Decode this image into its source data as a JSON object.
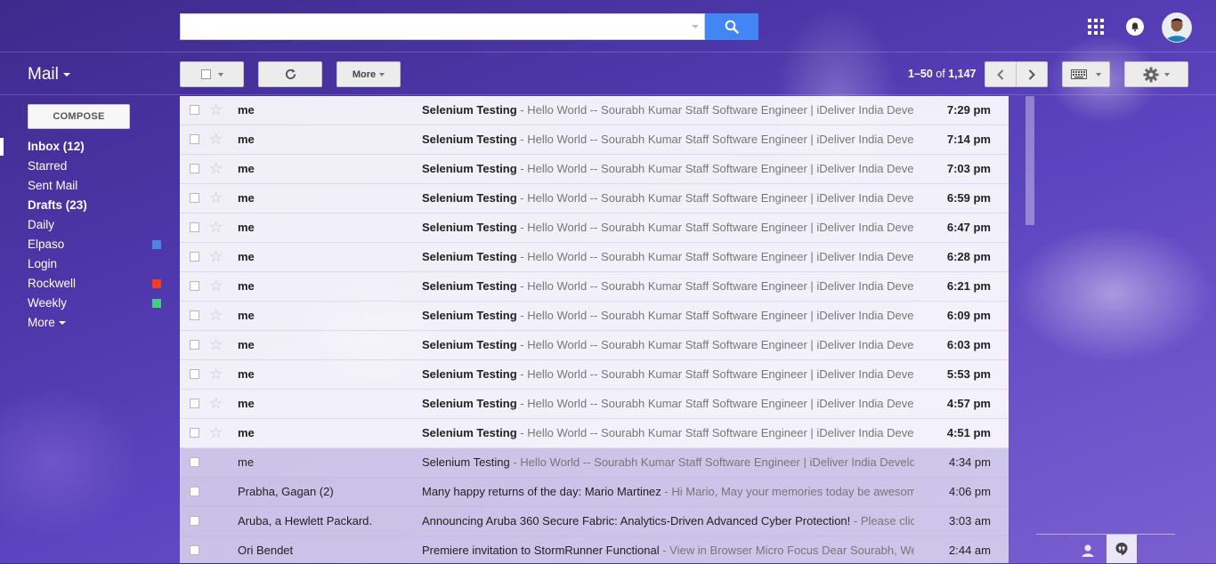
{
  "header": {
    "search": {
      "placeholder": "",
      "value": ""
    },
    "icons": [
      "apps-icon",
      "notifications-icon",
      "avatar"
    ]
  },
  "toolbar": {
    "app_label": "Mail",
    "more_label": "More",
    "pagination": {
      "range": "1–50",
      "of": "of",
      "total": "1,147"
    }
  },
  "sidebar": {
    "compose_label": "COMPOSE",
    "items": [
      {
        "label": "Inbox (12)",
        "bold": true,
        "active": true
      },
      {
        "label": "Starred"
      },
      {
        "label": "Sent Mail"
      },
      {
        "label": "Drafts (23)",
        "bold": true
      },
      {
        "label": "Daily"
      },
      {
        "label": "Elpaso",
        "color": "#4a86e8"
      },
      {
        "label": "Login"
      },
      {
        "label": "Rockwell",
        "color": "#f23c25"
      },
      {
        "label": "Weekly",
        "color": "#40d07a"
      }
    ],
    "more_label": "More"
  },
  "emails": [
    {
      "sender": "me",
      "subject": "Selenium Testing",
      "snippet": " - Hello World -- Sourabh Kumar Staff Software Engineer | iDeliver India Development Center",
      "time": "7:29 pm",
      "unread": true
    },
    {
      "sender": "me",
      "subject": "Selenium Testing",
      "snippet": " - Hello World -- Sourabh Kumar Staff Software Engineer | iDeliver India Development Center",
      "time": "7:14 pm",
      "unread": true
    },
    {
      "sender": "me",
      "subject": "Selenium Testing",
      "snippet": " - Hello World -- Sourabh Kumar Staff Software Engineer | iDeliver India Development Center",
      "time": "7:03 pm",
      "unread": true
    },
    {
      "sender": "me",
      "subject": "Selenium Testing",
      "snippet": " - Hello World -- Sourabh Kumar Staff Software Engineer | iDeliver India Development Center",
      "time": "6:59 pm",
      "unread": true
    },
    {
      "sender": "me",
      "subject": "Selenium Testing",
      "snippet": " - Hello World -- Sourabh Kumar Staff Software Engineer | iDeliver India Development Center",
      "time": "6:47 pm",
      "unread": true
    },
    {
      "sender": "me",
      "subject": "Selenium Testing",
      "snippet": " - Hello World -- Sourabh Kumar Staff Software Engineer | iDeliver India Development Center",
      "time": "6:28 pm",
      "unread": true
    },
    {
      "sender": "me",
      "subject": "Selenium Testing",
      "snippet": " - Hello World -- Sourabh Kumar Staff Software Engineer | iDeliver India Development Center",
      "time": "6:21 pm",
      "unread": true
    },
    {
      "sender": "me",
      "subject": "Selenium Testing",
      "snippet": " - Hello World -- Sourabh Kumar Staff Software Engineer | iDeliver India Development Center",
      "time": "6:09 pm",
      "unread": true
    },
    {
      "sender": "me",
      "subject": "Selenium Testing",
      "snippet": " - Hello World -- Sourabh Kumar Staff Software Engineer | iDeliver India Development Center",
      "time": "6:03 pm",
      "unread": true
    },
    {
      "sender": "me",
      "subject": "Selenium Testing",
      "snippet": " - Hello World -- Sourabh Kumar Staff Software Engineer | iDeliver India Development Center",
      "time": "5:53 pm",
      "unread": true
    },
    {
      "sender": "me",
      "subject": "Selenium Testing",
      "snippet": " - Hello World -- Sourabh Kumar Staff Software Engineer | iDeliver India Development Center",
      "time": "4:57 pm",
      "unread": true
    },
    {
      "sender": "me",
      "subject": "Selenium Testing",
      "snippet": " - Hello World -- Sourabh Kumar Staff Software Engineer | iDeliver India Development Center",
      "time": "4:51 pm",
      "unread": true
    },
    {
      "sender": "me",
      "subject": "Selenium Testing",
      "snippet": " - Hello World -- Sourabh Kumar Staff Software Engineer | iDeliver India Development Center",
      "time": "4:34 pm",
      "unread": false,
      "highlight": true
    },
    {
      "sender": "Prabha, Gagan (2)",
      "subject": "Many happy returns of the day: Mario Martinez",
      "snippet": " - Hi Mario, May your memories today be awesome",
      "time": "4:06 pm",
      "unread": false
    },
    {
      "sender": "Aruba, a Hewlett Packard.",
      "subject": "Announcing Aruba 360 Secure Fabric: Analytics-Driven Advanced Cyber Protection!",
      "snippet": " - Please click",
      "time": "3:03 am",
      "unread": false
    },
    {
      "sender": "Ori Bendet",
      "subject": "Premiere invitation to StormRunner Functional",
      "snippet": " - View in Browser Micro Focus Dear Sourabh, We are",
      "time": "2:44 am",
      "unread": false
    }
  ]
}
